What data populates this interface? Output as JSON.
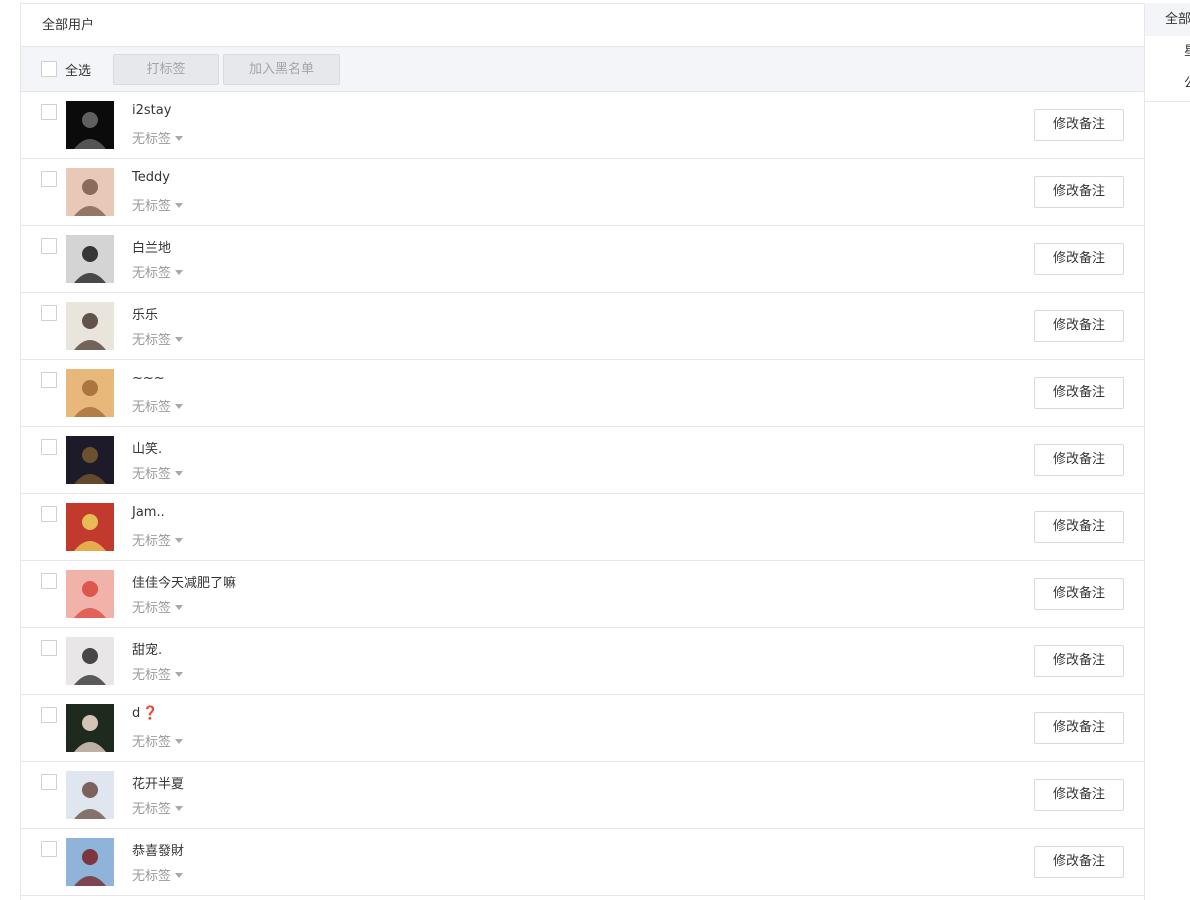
{
  "panel": {
    "title": "全部用户"
  },
  "toolbar": {
    "select_all_label": "全选",
    "tag_button": "打标签",
    "blacklist_button": "加入黑名单"
  },
  "side_panel": {
    "header": "全部",
    "items": [
      "星",
      "公"
    ]
  },
  "users": [
    {
      "name": "i2stay",
      "tag": "无标签",
      "action": "修改备注"
    },
    {
      "name": "Teddy",
      "tag": "无标签",
      "action": "修改备注"
    },
    {
      "name": "白兰地",
      "tag": "无标签",
      "action": "修改备注"
    },
    {
      "name": "乐乐",
      "tag": "无标签",
      "action": "修改备注"
    },
    {
      "name": "~~~",
      "tag": "无标签",
      "action": "修改备注"
    },
    {
      "name": "山笑.",
      "tag": "无标签",
      "action": "修改备注"
    },
    {
      "name": "Jam..",
      "tag": "无标签",
      "action": "修改备注"
    },
    {
      "name": "佳佳今天减肥了嘛",
      "tag": "无标签",
      "action": "修改备注"
    },
    {
      "name": "甜宠.",
      "tag": "无标签",
      "action": "修改备注"
    },
    {
      "name": "d",
      "tag": "无标签",
      "action": "修改备注",
      "emoji": "❓"
    },
    {
      "name": "花开半夏",
      "tag": "无标签",
      "action": "修改备注"
    },
    {
      "name": "恭喜發財",
      "tag": "无标签",
      "action": "修改备注"
    }
  ],
  "avatar_colors": [
    [
      "#0b0b0b",
      "#6e6e6e"
    ],
    [
      "#e8c9b8",
      "#7a5a4a"
    ],
    [
      "#d4d4d4",
      "#1a1a1a"
    ],
    [
      "#e9e4dc",
      "#4a3a30"
    ],
    [
      "#e8b77a",
      "#a06a35"
    ],
    [
      "#1d1b2a",
      "#7a5a30"
    ],
    [
      "#c23a2e",
      "#f0d25a"
    ],
    [
      "#f1b2a9",
      "#d9473e"
    ],
    [
      "#e8e6e6",
      "#2a2a2a"
    ],
    [
      "#1f2a1f",
      "#f3dfd4"
    ],
    [
      "#dfe6f0",
      "#6a4a40"
    ],
    [
      "#8fb3d9",
      "#7a1f24"
    ]
  ]
}
